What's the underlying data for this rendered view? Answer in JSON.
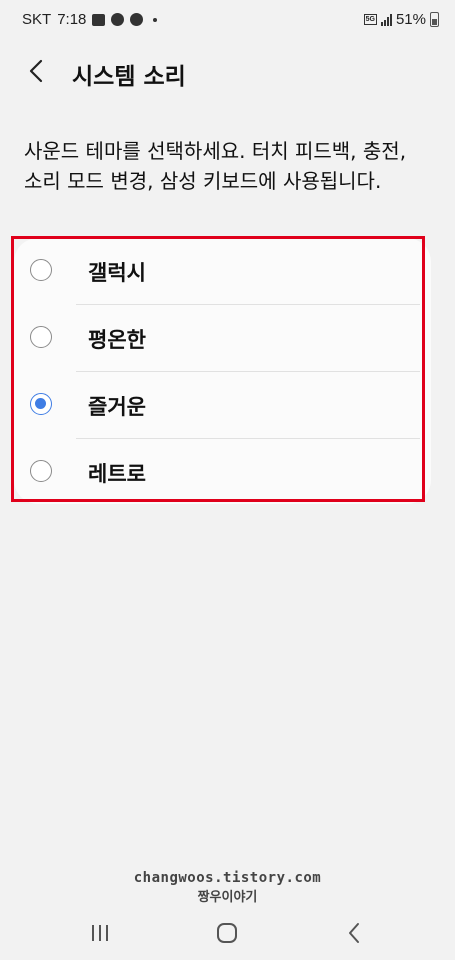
{
  "status_bar": {
    "carrier": "SKT",
    "time": "7:18",
    "network": "5G",
    "battery": "51%"
  },
  "header": {
    "title": "시스템 소리"
  },
  "description": "사운드 테마를 선택하세요. 터치 피드백, 충전, 소리 모드 변경, 삼성 키보드에 사용됩니다.",
  "sound_themes": [
    {
      "label": "갤럭시",
      "selected": false
    },
    {
      "label": "평온한",
      "selected": false
    },
    {
      "label": "즐거운",
      "selected": true
    },
    {
      "label": "레트로",
      "selected": false
    }
  ],
  "highlight_color": "#e0001b",
  "accent_color": "#3f7de4",
  "watermark": {
    "line1": "changwoos.tistory.com",
    "line2": "짱우이야기"
  },
  "nav": {
    "recents_icon": "recents-icon",
    "home_icon": "home-icon",
    "back_icon": "back-icon"
  }
}
